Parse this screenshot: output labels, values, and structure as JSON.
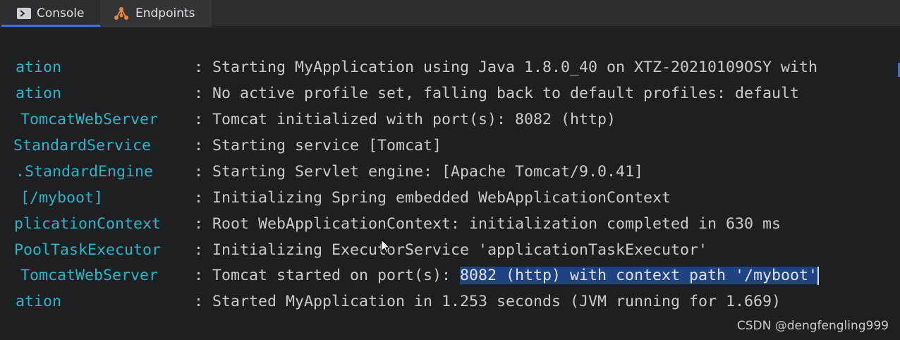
{
  "tabs": [
    {
      "label": "Console",
      "icon": "console-icon",
      "active": true
    },
    {
      "label": "Endpoints",
      "icon": "endpoints-icon",
      "active": false
    }
  ],
  "log": [
    {
      "logger": "ation",
      "message": ": Starting MyApplication using Java 1.8.0_40 on XTZ-20210109OSY with"
    },
    {
      "logger": "ation",
      "message": ": No active profile set, falling back to default profiles: default"
    },
    {
      "logger": " TomcatWebServer",
      "message": ": Tomcat initialized with port(s): 8082 (http)"
    },
    {
      "logger": "StandardService",
      "message": ": Starting service [Tomcat]"
    },
    {
      "logger": ".StandardEngine",
      "message": ": Starting Servlet engine: [Apache Tomcat/9.0.41]"
    },
    {
      "logger": " [/myboot]",
      "message": ": Initializing Spring embedded WebApplicationContext"
    },
    {
      "logger": "plicationContext",
      "message": ": Root WebApplicationContext: initialization completed in 630 ms"
    },
    {
      "logger": "PoolTaskExecutor",
      "message": ": Initializing ExecutorService 'applicationTaskExecutor'"
    },
    {
      "logger": " TomcatWebServer",
      "message_prefix": ": Tomcat started on port(s): ",
      "message_selected": "8082 (http) with context path '/myboot'"
    },
    {
      "logger": "ation",
      "message": ": Started MyApplication in 1.253 seconds (JVM running for 1.669)"
    }
  ],
  "watermark": "CSDN @dengfengling999",
  "colors": {
    "logger": "#2ab5c7",
    "message": "#c9cbcf",
    "selection": "#214283",
    "accent": "#3574f0"
  }
}
